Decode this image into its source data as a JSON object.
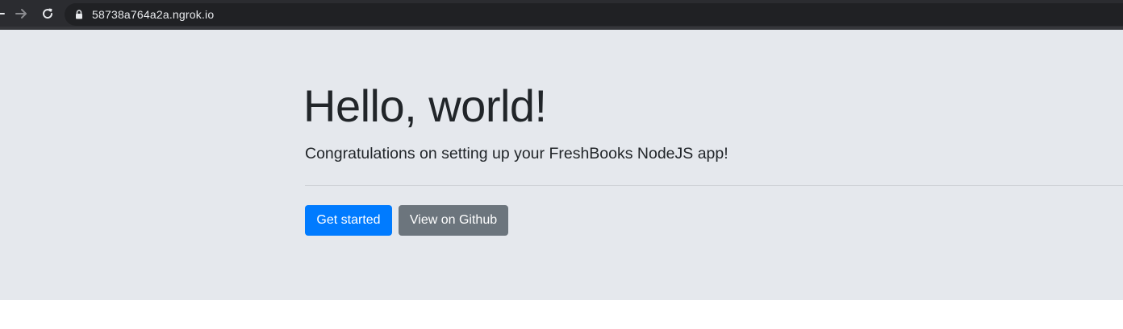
{
  "browser": {
    "url": "58738a764a2a.ngrok.io",
    "icons": {
      "back": "arrow-left-icon",
      "forward": "arrow-right-icon",
      "reload": "reload-icon",
      "lock": "lock-icon"
    },
    "colors": {
      "toolbar": "#2b2c30",
      "address_bar": "#202124",
      "text": "#e8eaed"
    }
  },
  "jumbotron": {
    "title": "Hello, world!",
    "lead": "Congratulations on setting up your FreshBooks NodeJS app!",
    "background": "#e5e8ed"
  },
  "actions": {
    "get_started_label": "Get started",
    "github_label": "View on Github",
    "primary_color": "#007bff",
    "secondary_color": "#6c757d"
  }
}
